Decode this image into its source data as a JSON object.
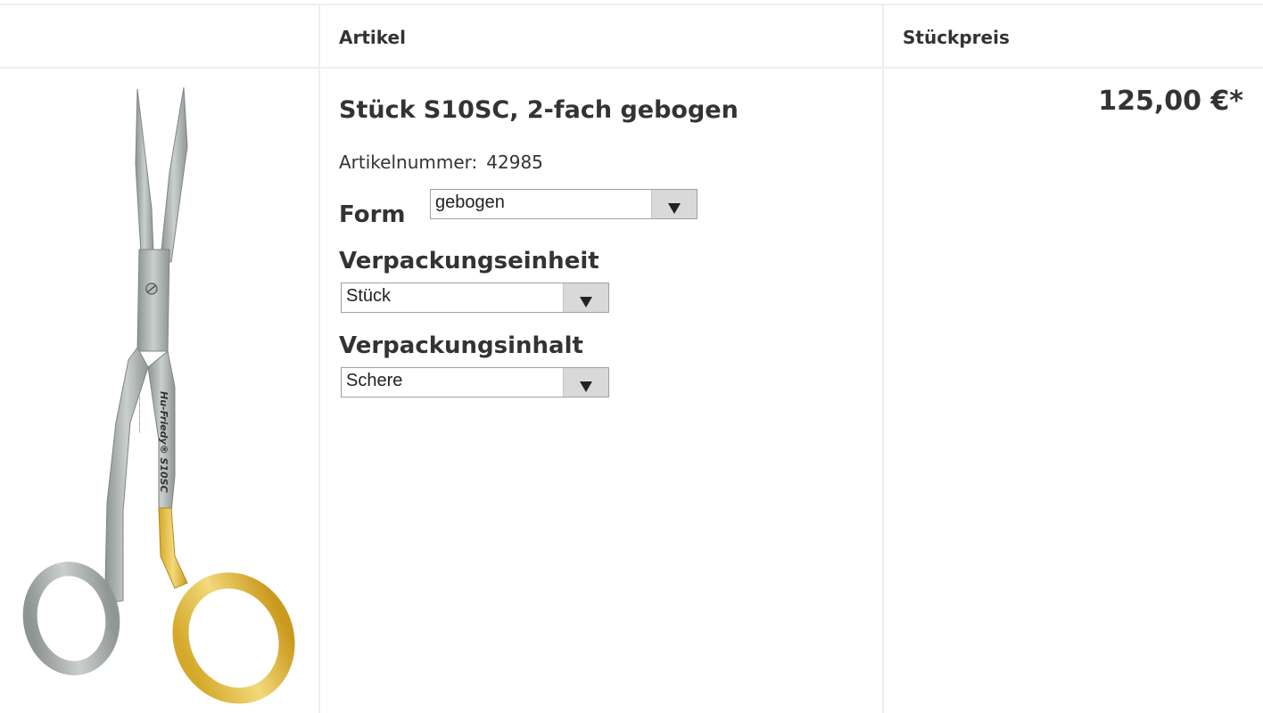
{
  "header": {
    "col_article": "Artikel",
    "col_unit_price": "Stückpreis"
  },
  "product": {
    "title": "Stück S10SC, 2-fach gebogen",
    "article_number_label": "Artikelnummer:",
    "article_number": "42985",
    "image_alt": "Hu-Friedy S10SC scissors",
    "image_engraving": "Hu-Friedy® S10SC",
    "price": "125,00 €*"
  },
  "options": {
    "form": {
      "label": "Form",
      "selected": "gebogen"
    },
    "packaging_unit": {
      "label": "Verpackungseinheit",
      "selected": "Stück"
    },
    "packaging_content": {
      "label": "Verpackungsinhalt",
      "selected": "Schere"
    }
  },
  "colors": {
    "border": "#eeeeee",
    "text": "#333333",
    "gold": "#e8c14a",
    "steel": "#a9b0ad"
  }
}
